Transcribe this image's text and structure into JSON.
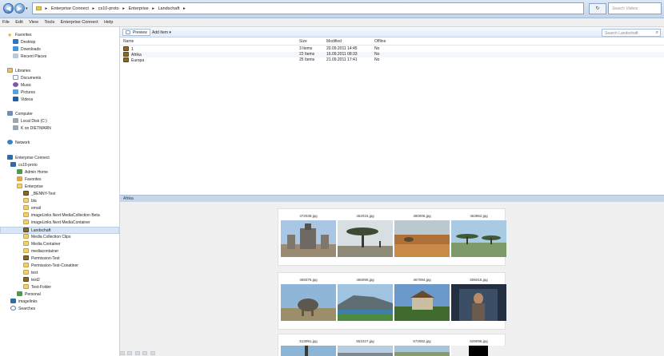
{
  "address_bar": {
    "crumbs": [
      "Enterprise Connect",
      "cs10-proto",
      "Enterprise",
      "Landschaft"
    ],
    "search_placeholder": "Search Videos",
    "refresh_glyph": "↻"
  },
  "menu": [
    "File",
    "Edit",
    "View",
    "Tools",
    "Enterprise Connect",
    "Help"
  ],
  "sidebar": {
    "items": [
      {
        "label": "Favorites",
        "icon": "star-icon"
      },
      {
        "label": "Desktop",
        "icon": "desktop-icon"
      },
      {
        "label": "Downloads",
        "icon": "downloads-icon"
      },
      {
        "label": "Recent Places",
        "icon": "recent-places-icon"
      },
      {
        "label": "Libraries",
        "icon": "libraries-icon"
      },
      {
        "label": "Documents",
        "icon": "documents-icon"
      },
      {
        "label": "Music",
        "icon": "music-icon"
      },
      {
        "label": "Pictures",
        "icon": "pictures-icon"
      },
      {
        "label": "Videos",
        "icon": "videos-icon"
      },
      {
        "label": "Computer",
        "icon": "computer-icon"
      },
      {
        "label": "Local Disk (C:)",
        "icon": "disk-icon"
      },
      {
        "label": "K on DIETMARN",
        "icon": "network-drive-icon"
      },
      {
        "label": "Network",
        "icon": "network-icon"
      },
      {
        "label": "Enterprise Connect",
        "icon": "enterprise-connect-icon"
      },
      {
        "label": "cs10-proto",
        "icon": "server-icon"
      },
      {
        "label": "Admin Home",
        "icon": "admin-home-icon"
      },
      {
        "label": "Favorites",
        "icon": "favorites-icon"
      },
      {
        "label": "Enterprise",
        "icon": "folder-open-icon"
      },
      {
        "label": "_BENNY-Test",
        "icon": "folder-icon"
      },
      {
        "label": "bla",
        "icon": "folder-icon"
      },
      {
        "label": "email",
        "icon": "folder-icon"
      },
      {
        "label": "imageLinks.Next MediaCollection Beta",
        "icon": "folder-icon"
      },
      {
        "label": "imageLinks.Next MediaContainer",
        "icon": "folder-icon"
      },
      {
        "label": "Landschaft",
        "icon": "folder-icon"
      },
      {
        "label": "Media Collection Clips",
        "icon": "folder-icon"
      },
      {
        "label": "Media Container",
        "icon": "folder-icon"
      },
      {
        "label": "mediacontainer",
        "icon": "folder-icon"
      },
      {
        "label": "Permission-Test",
        "icon": "folder-icon"
      },
      {
        "label": "Permission-Test-Conatiner",
        "icon": "folder-icon"
      },
      {
        "label": "test",
        "icon": "folder-icon"
      },
      {
        "label": "test2",
        "icon": "folder-icon"
      },
      {
        "label": "Test-Folder",
        "icon": "folder-icon"
      },
      {
        "label": "Personal",
        "icon": "personal-icon"
      },
      {
        "label": "imagelinks",
        "icon": "imagelinks-icon"
      },
      {
        "label": "Searches",
        "icon": "searches-icon"
      }
    ]
  },
  "toolbar": {
    "preview_label": "Preview",
    "add_item_label": "Add Item ▾",
    "search_placeholder": "Search Landschaft",
    "search_glyph": "⌕"
  },
  "file_list": {
    "columns": [
      "Name",
      "Size",
      "Modified",
      "Offline"
    ],
    "rows": [
      {
        "name": "1",
        "size": "3 Items",
        "modified": "20.09.2011 14:45",
        "offline": "No"
      },
      {
        "name": "Afrika",
        "size": "22 Items",
        "modified": "16.09.2011 08:33",
        "offline": "No"
      },
      {
        "name": "Europa",
        "size": "25 Items",
        "modified": "21.09.2011 17:41",
        "offline": "No"
      }
    ]
  },
  "preview": {
    "title": "Afrika",
    "rows": [
      [
        "472038.jpg",
        "462016.jpg",
        "480006.jpg",
        "463962.jpg"
      ],
      [
        "469375.jpg",
        "466090.jpg",
        "467094.jpg",
        "506015.jpg"
      ],
      [
        "513091.jpg",
        "551027.jpg",
        "572062.jpg",
        "629096.jpg"
      ]
    ]
  },
  "statusbar": [
    "",
    "",
    "",
    "",
    ""
  ]
}
